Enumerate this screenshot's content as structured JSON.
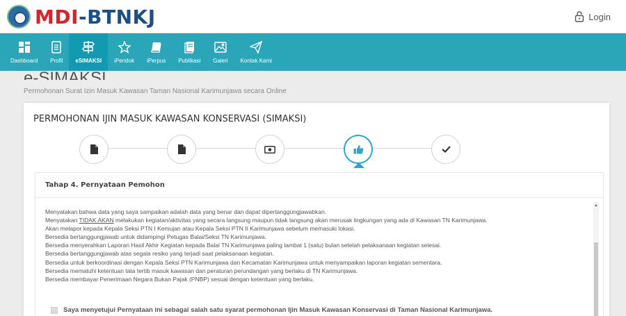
{
  "header": {
    "logo_text": "MDI-BTNKJ",
    "login_label": "Login"
  },
  "nav": {
    "items": [
      {
        "label": "Dashboard",
        "icon": "grid-icon"
      },
      {
        "label": "Profil",
        "icon": "profile-icon"
      },
      {
        "label": "eSIMAKSI",
        "icon": "signpost-icon",
        "active": true
      },
      {
        "label": "iPendok",
        "icon": "star-icon"
      },
      {
        "label": "iPerpus",
        "icon": "book-icon"
      },
      {
        "label": "Publikasi",
        "icon": "document-icon"
      },
      {
        "label": "Galeri",
        "icon": "image-icon"
      },
      {
        "label": "Kontak Kami",
        "icon": "send-icon"
      }
    ]
  },
  "page": {
    "title": "e-SIMAKSI",
    "subtitle": "Permohonan Surat Izin Masuk Kawasan Taman Nasional Karimunjawa secara Online"
  },
  "card": {
    "title": "PERMOHONAN IJIN MASUK KAWASAN KONSERVASI (SIMAKSI)",
    "steps": [
      {
        "icon": "file-icon"
      },
      {
        "icon": "file-icon"
      },
      {
        "icon": "money-icon"
      },
      {
        "icon": "thumbs-up-icon",
        "active": true
      },
      {
        "icon": "checkmark-icon"
      }
    ],
    "section_title": "Tahap 4. Pernyataan Pemohon",
    "statements": [
      "Menyatakan bahwa data yang saya sampaikan adalah data yang benar dan dapat dipertanggungjawabkan.",
      "melakukan kegiatan/aktivitas yang secara langsung maupun tidak langsung akan merusak lingkungan yang ada di Kawasan TN Karimunjawa.",
      "Akan melapor kepada Kepala Seksi PTN I Kemujan atau Kepala Seksi PTN II Karimunjawa sebelum memasuki lokasi.",
      "Bersedia bertanggungjawab untuk didampingi Petugas Balai/Seksi TN Karimunjawa.",
      "Bersedia menyerahkan Laporan Hasil Akhir Kegiatan kepada Balai TN Karimunjawa paling lambat 1 (satu) bulan setelah pelaksanaan kegiatan selesai.",
      "Bersedia bertanggungjawab atas segala resiko yang terjadi saat pelaksanaan kegiatan.",
      "Bersedia untuk berkoordinasi dengan Kepala Seksi PTN Karimunjawa dan Kecamatan Karimunjawa untuk menyampaikan laporan kegiatan sementara.",
      "Bersedia mematuhi ketentuan tata tertib masuk kawasan dan peraturan perundangan yang berlaku di TN Karimunjawa.",
      "Bersedia membayar Penerimaan Negara Bukan Pajak (PNBP) sesuai dengan ketentuan yang berlaku."
    ],
    "statement2_prefix": "Menyatakan",
    "statement2_emphasis": "TIDAK AKAN",
    "agree_label": "Saya menyetujui Pernyataan ini sebagai salah satu syarat permohonan Ijin Masuk Kawasan Konservasi di Taman Nasional Karimunjawa.",
    "agree_checked": false
  },
  "colors": {
    "navbar": "#2aa6b8",
    "nav_active": "#149ab0",
    "accent": "#2aa6d6",
    "logo_red": "#d8232a",
    "logo_blue": "#1d4f86"
  }
}
